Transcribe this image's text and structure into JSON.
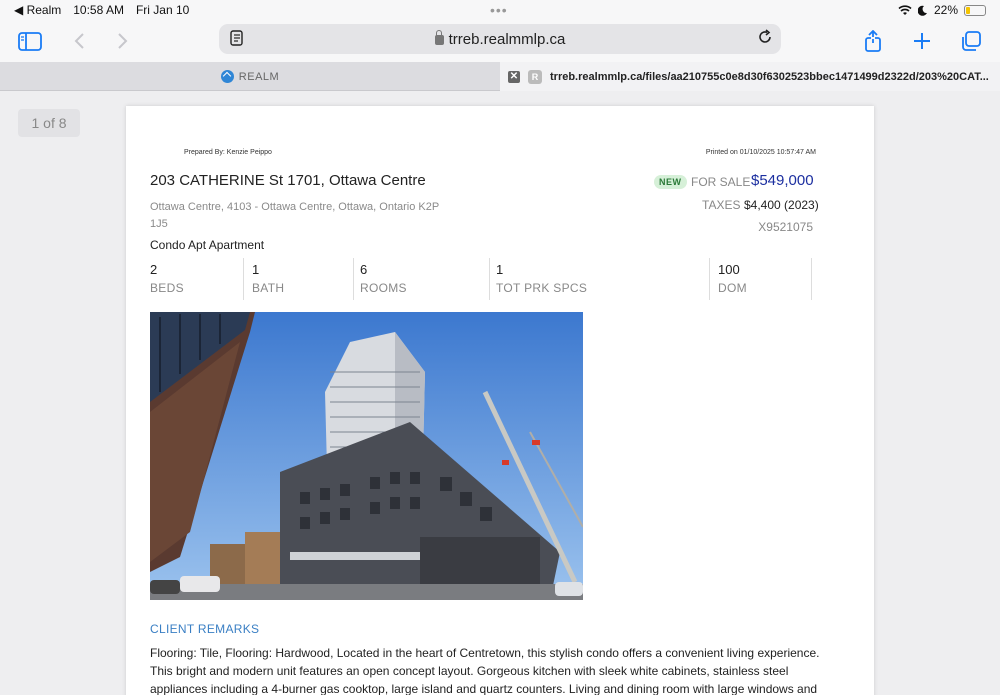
{
  "status_bar": {
    "back_app": "◀ Realm",
    "time": "10:58 AM",
    "date": "Fri Jan 10",
    "battery": "22%",
    "battery_level": 0.22
  },
  "browser": {
    "url": "trreb.realmmlp.ca",
    "tabs": [
      {
        "title": "REALM"
      },
      {
        "title": "trreb.realmmlp.ca/files/aa210755c0e8d30f6302523bbec1471499d2322d/203%20CAT..."
      }
    ]
  },
  "viewer": {
    "page_indicator": "1 of 8"
  },
  "listing": {
    "prepared_by": "Prepared By: Kenzie Peippo",
    "printed_on": "Printed on 01/10/2025 10:57:47 AM",
    "address": "203 CATHERINE St 1701, Ottawa Centre",
    "badge": "NEW",
    "status": "FOR SALE",
    "price": "$549,000",
    "sub_address_line1": "Ottawa Centre, 4103 - Ottawa Centre, Ottawa, Ontario K2P",
    "sub_address_line2": "1J5",
    "taxes_label": "TAXES",
    "taxes_value": "$4,400 (2023)",
    "mls_number": "X9521075",
    "property_type": "Condo Apt Apartment",
    "stats": [
      {
        "value": "2",
        "label": "BEDS"
      },
      {
        "value": "1",
        "label": "BATH"
      },
      {
        "value": "6",
        "label": "ROOMS"
      },
      {
        "value": "1",
        "label": "TOT PRK SPCS"
      },
      {
        "value": "100",
        "label": "DOM"
      }
    ],
    "remarks_heading": "CLIENT REMARKS",
    "remarks_text": "Flooring: Tile, Flooring: Hardwood, Located in the heart of Centretown, this stylish condo offers a convenient living experience. This bright and modern unit features an open concept layout. Gorgeous kitchen with sleek white cabinets, stainless steel appliances including a 4-burner gas cooktop, large island and quartz counters. Living and dining room with large windows and access to the private"
  },
  "colors": {
    "accent": "#1a7cf5",
    "price": "#1c2fa0",
    "badge_bg": "#d6f0d8",
    "remarks_heading": "#3a7fc4"
  }
}
